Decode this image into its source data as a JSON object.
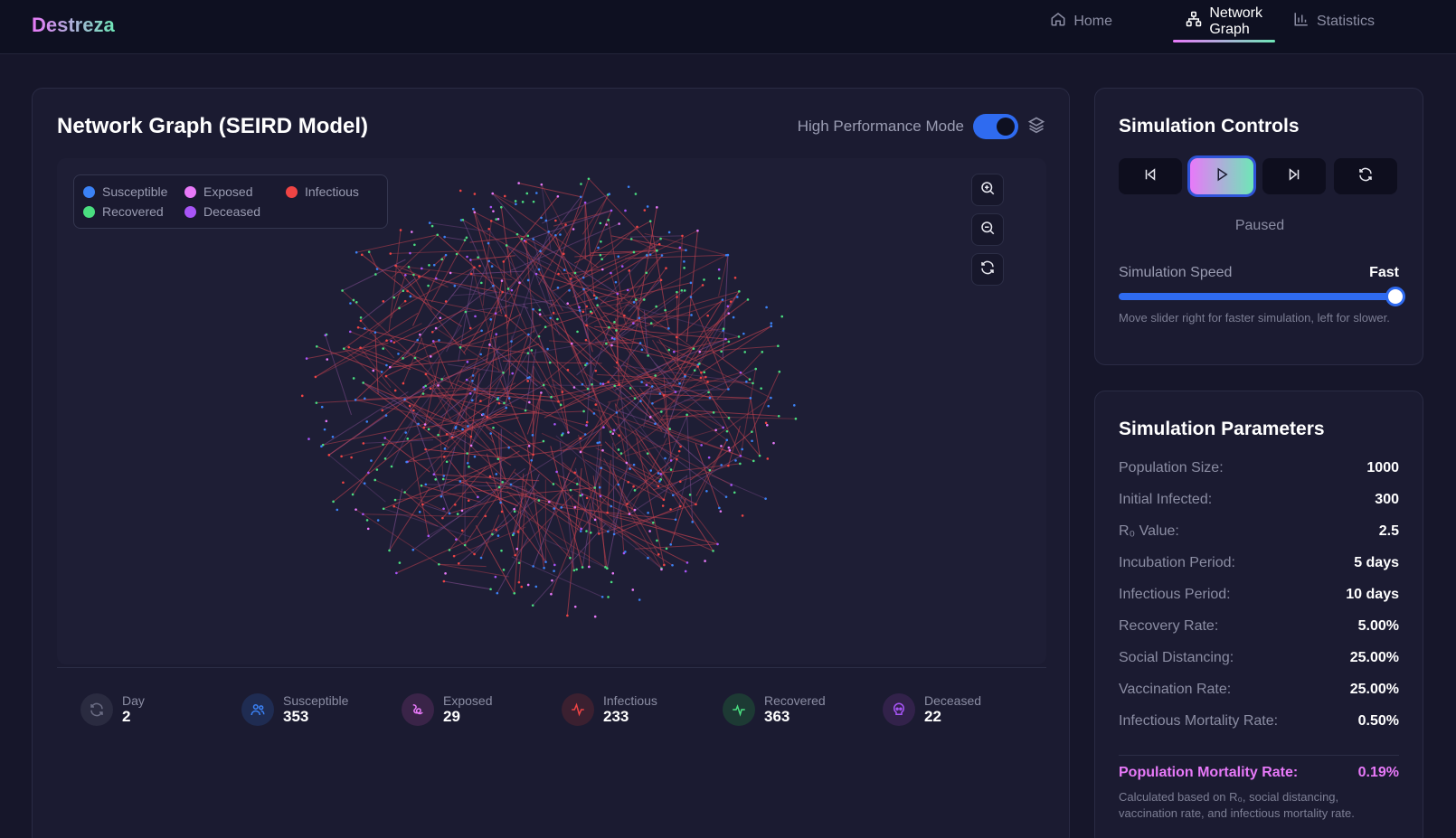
{
  "app": {
    "brand": "Destreza"
  },
  "nav": {
    "items": [
      {
        "label": "Home",
        "icon": "home-icon",
        "active": false
      },
      {
        "label": "Network Graph",
        "icon": "network-icon",
        "active": true
      },
      {
        "label": "Statistics",
        "icon": "bar-chart-icon",
        "active": false
      }
    ]
  },
  "graph": {
    "title": "Network Graph (SEIRD Model)",
    "performance_mode_label": "High Performance Mode",
    "performance_mode_on": true,
    "legend": [
      {
        "label": "Susceptible",
        "color": "#3b82f6"
      },
      {
        "label": "Exposed",
        "color": "#e879f9"
      },
      {
        "label": "Infectious",
        "color": "#ef4444"
      },
      {
        "label": "Recovered",
        "color": "#4ade80"
      },
      {
        "label": "Deceased",
        "color": "#a855f7"
      }
    ],
    "zoom_buttons": [
      "zoom-in-icon",
      "zoom-out-icon",
      "reset-icon"
    ]
  },
  "stats": [
    {
      "label": "Day",
      "value": "2",
      "icon": "refresh-icon",
      "color": "#8b8da3"
    },
    {
      "label": "Susceptible",
      "value": "353",
      "icon": "users-icon",
      "color": "#3b82f6"
    },
    {
      "label": "Exposed",
      "value": "29",
      "icon": "squiggle-icon",
      "color": "#e879f9"
    },
    {
      "label": "Infectious",
      "value": "233",
      "icon": "pulse-icon",
      "color": "#ef4444"
    },
    {
      "label": "Recovered",
      "value": "363",
      "icon": "heartbeat-icon",
      "color": "#4ade80"
    },
    {
      "label": "Deceased",
      "value": "22",
      "icon": "skull-icon",
      "color": "#a855f7"
    }
  ],
  "controls": {
    "title": "Simulation Controls",
    "status": "Paused",
    "speed_label": "Simulation Speed",
    "speed_value": "Fast",
    "speed_fraction": 1.0,
    "speed_help": "Move slider right for faster simulation, left for slower."
  },
  "params": {
    "title": "Simulation Parameters",
    "rows": [
      {
        "k": "Population Size:",
        "v": "1000"
      },
      {
        "k": "Initial Infected:",
        "v": "300"
      },
      {
        "k": "R₀ Value:",
        "v": "2.5"
      },
      {
        "k": "Incubation Period:",
        "v": "5 days"
      },
      {
        "k": "Infectious Period:",
        "v": "10 days"
      },
      {
        "k": "Recovery Rate:",
        "v": "5.00%"
      },
      {
        "k": "Social Distancing:",
        "v": "25.00%"
      },
      {
        "k": "Vaccination Rate:",
        "v": "25.00%"
      },
      {
        "k": "Infectious Mortality Rate:",
        "v": "0.50%"
      }
    ],
    "mortality_label": "Population Mortality Rate:",
    "mortality_value": "0.19%",
    "mortality_help": "Calculated based on R₀, social distancing, vaccination rate, and infectious mortality rate."
  }
}
